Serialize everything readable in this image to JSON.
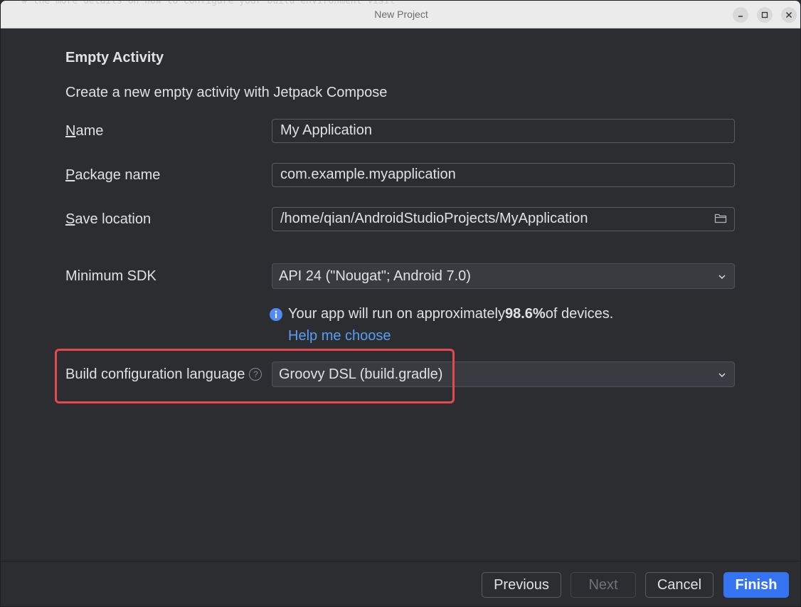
{
  "window": {
    "title": "New Project",
    "background_text": "# the more details on how to configure your build environment visit"
  },
  "page": {
    "heading": "Empty Activity",
    "subheading": "Create a new empty activity with Jetpack Compose"
  },
  "form": {
    "name": {
      "mnemonic": "N",
      "label_rest": "ame",
      "value": "My Application"
    },
    "package": {
      "mnemonic": "P",
      "label_rest": "ackage name",
      "value": "com.example.myapplication"
    },
    "save_location": {
      "mnemonic": "S",
      "label_rest": "ave location",
      "value": "/home/qian/AndroidStudioProjects/MyApplication",
      "icon": "folder-icon"
    },
    "min_sdk": {
      "label": "Minimum SDK",
      "value": "API 24 (\"Nougat\"; Android 7.0)"
    },
    "info": {
      "prefix": "Your app will run on approximately ",
      "percent": "98.6%",
      "suffix": " of devices.",
      "icon": "info-icon"
    },
    "help_link": "Help me choose",
    "build_config": {
      "label": "Build configuration language",
      "help_glyph": "?",
      "value": "Groovy DSL (build.gradle)"
    }
  },
  "footer": {
    "previous": "Previous",
    "next": "Next",
    "cancel": "Cancel",
    "finish": "Finish"
  },
  "colors": {
    "accent": "#3574f0",
    "link": "#589df6",
    "highlight": "#e5484d",
    "info_icon": "#548af7",
    "background": "#2b2d30"
  }
}
